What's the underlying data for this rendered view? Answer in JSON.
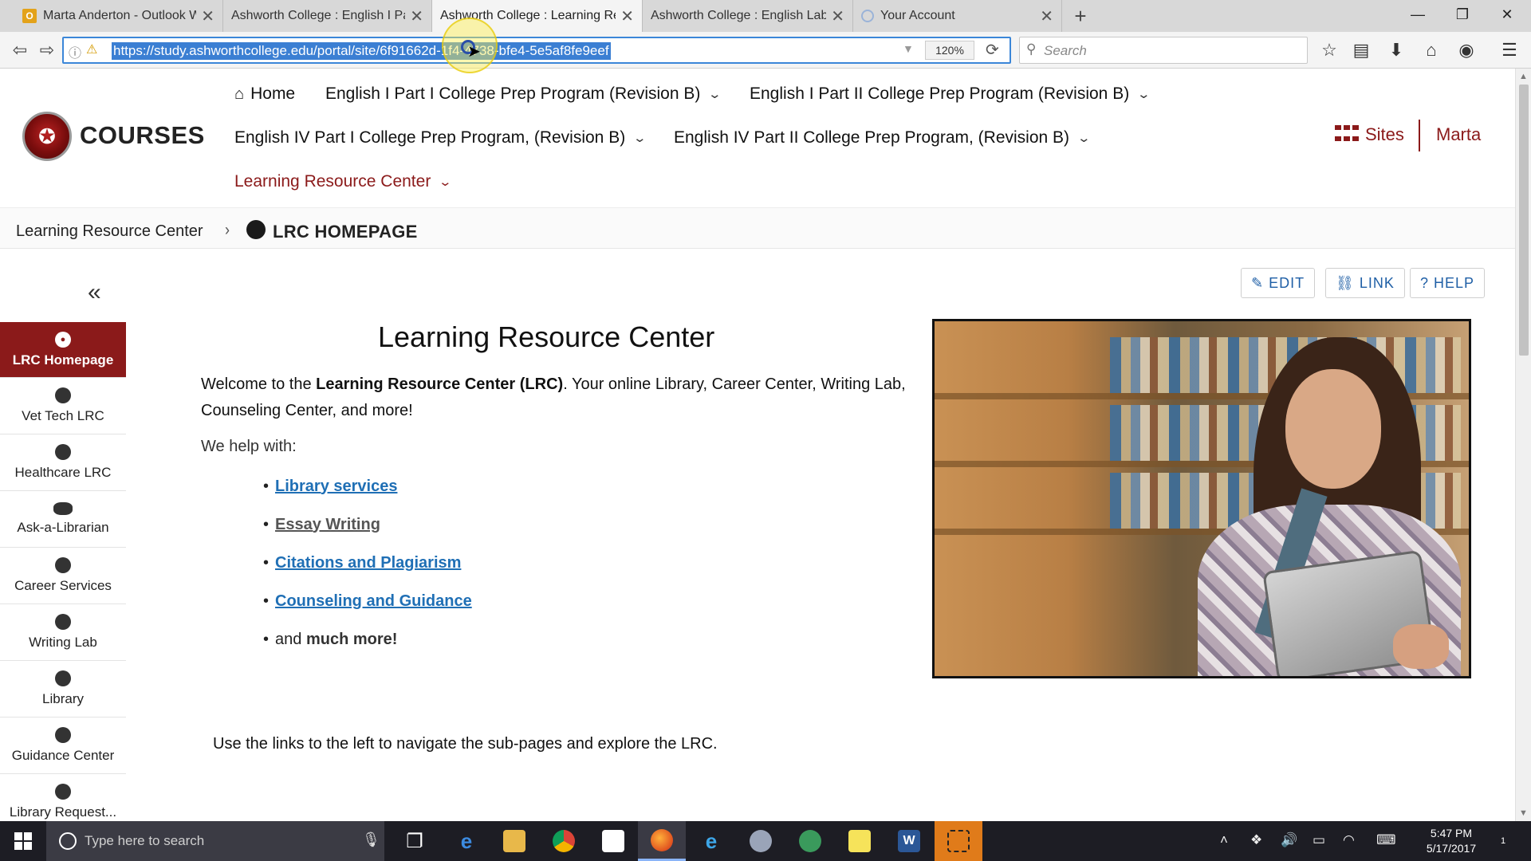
{
  "browser": {
    "tabs": [
      {
        "title": "Marta Anderton - Outlook W",
        "favicon_label": "O",
        "favicon_color": "#e3a21a",
        "active": false
      },
      {
        "title": "Ashworth College : English I Part",
        "favicon_label": "",
        "favicon_color": "",
        "active": false
      },
      {
        "title": "Ashworth College : Learning Res",
        "favicon_label": "",
        "favicon_color": "",
        "active": true
      },
      {
        "title": "Ashworth College : English Lab :",
        "favicon_label": "",
        "favicon_color": "",
        "active": false
      },
      {
        "title": "Your Account",
        "favicon_label": "",
        "favicon_color": "#9ab3d8",
        "active": false
      }
    ],
    "url": "https://study.ashworthcollege.edu/portal/site/6f91662d-1f4-4738-bfe4-5e5af8fe9eef",
    "zoom": "120%",
    "search_placeholder": "Search"
  },
  "site": {
    "brand": "COURSES",
    "nav": [
      {
        "label": "Home",
        "has_dropdown": false
      },
      {
        "label": "English I Part I College Prep Program (Revision B)",
        "has_dropdown": true
      },
      {
        "label": "English I Part II College Prep Program (Revision B)",
        "has_dropdown": true
      },
      {
        "label": "English IV Part I College Prep Program, (Revision B)",
        "has_dropdown": true
      },
      {
        "label": "English IV Part II College Prep Program, (Revision B)",
        "has_dropdown": true
      },
      {
        "label": "Learning Resource Center",
        "has_dropdown": true
      }
    ],
    "sites_label": "Sites",
    "user_name": "Marta",
    "accent_color": "#8b1a1a"
  },
  "breadcrumb": {
    "parent": "Learning Resource Center",
    "current": "LRC HOMEPAGE"
  },
  "tool_menu": [
    {
      "label": "LRC Homepage",
      "icon": "globe-icon",
      "active": true
    },
    {
      "label": "Vet Tech LRC",
      "icon": "globe-icon",
      "active": false
    },
    {
      "label": "Healthcare LRC",
      "icon": "globe-icon",
      "active": false
    },
    {
      "label": "Ask-a-Librarian",
      "icon": "chat-icon",
      "active": false
    },
    {
      "label": "Career Services",
      "icon": "globe-icon",
      "active": false
    },
    {
      "label": "Writing Lab",
      "icon": "globe-icon",
      "active": false
    },
    {
      "label": "Library",
      "icon": "globe-icon",
      "active": false
    },
    {
      "label": "Guidance Center",
      "icon": "globe-icon",
      "active": false
    },
    {
      "label": "Library Request...",
      "icon": "globe-icon",
      "active": false
    }
  ],
  "actions": {
    "edit": "EDIT",
    "link": "LINK",
    "help": "HELP"
  },
  "content": {
    "title": "Learning Resource Center",
    "welcome_prefix": "Welcome to the ",
    "welcome_bold": "Learning Resource Center (LRC)",
    "welcome_suffix": ".  Your online Library, Career Center, Writing Lab, Counseling Center, and more!",
    "help_intro": "We help with:",
    "links": [
      {
        "label": "Library services",
        "visited": false
      },
      {
        "label": "Essay Writing",
        "visited": true
      },
      {
        "label": "Citations and Plagiarism",
        "visited": false
      },
      {
        "label": "Counseling and Guidance",
        "visited": false
      }
    ],
    "more_prefix": "and ",
    "more_bold": "much more!",
    "nav_note": "Use the links to the left to navigate the sub-pages and explore the LRC."
  },
  "taskbar": {
    "search_placeholder": "Type here to search",
    "time": "5:47 PM",
    "date": "5/17/2017",
    "notification_count": "1"
  }
}
